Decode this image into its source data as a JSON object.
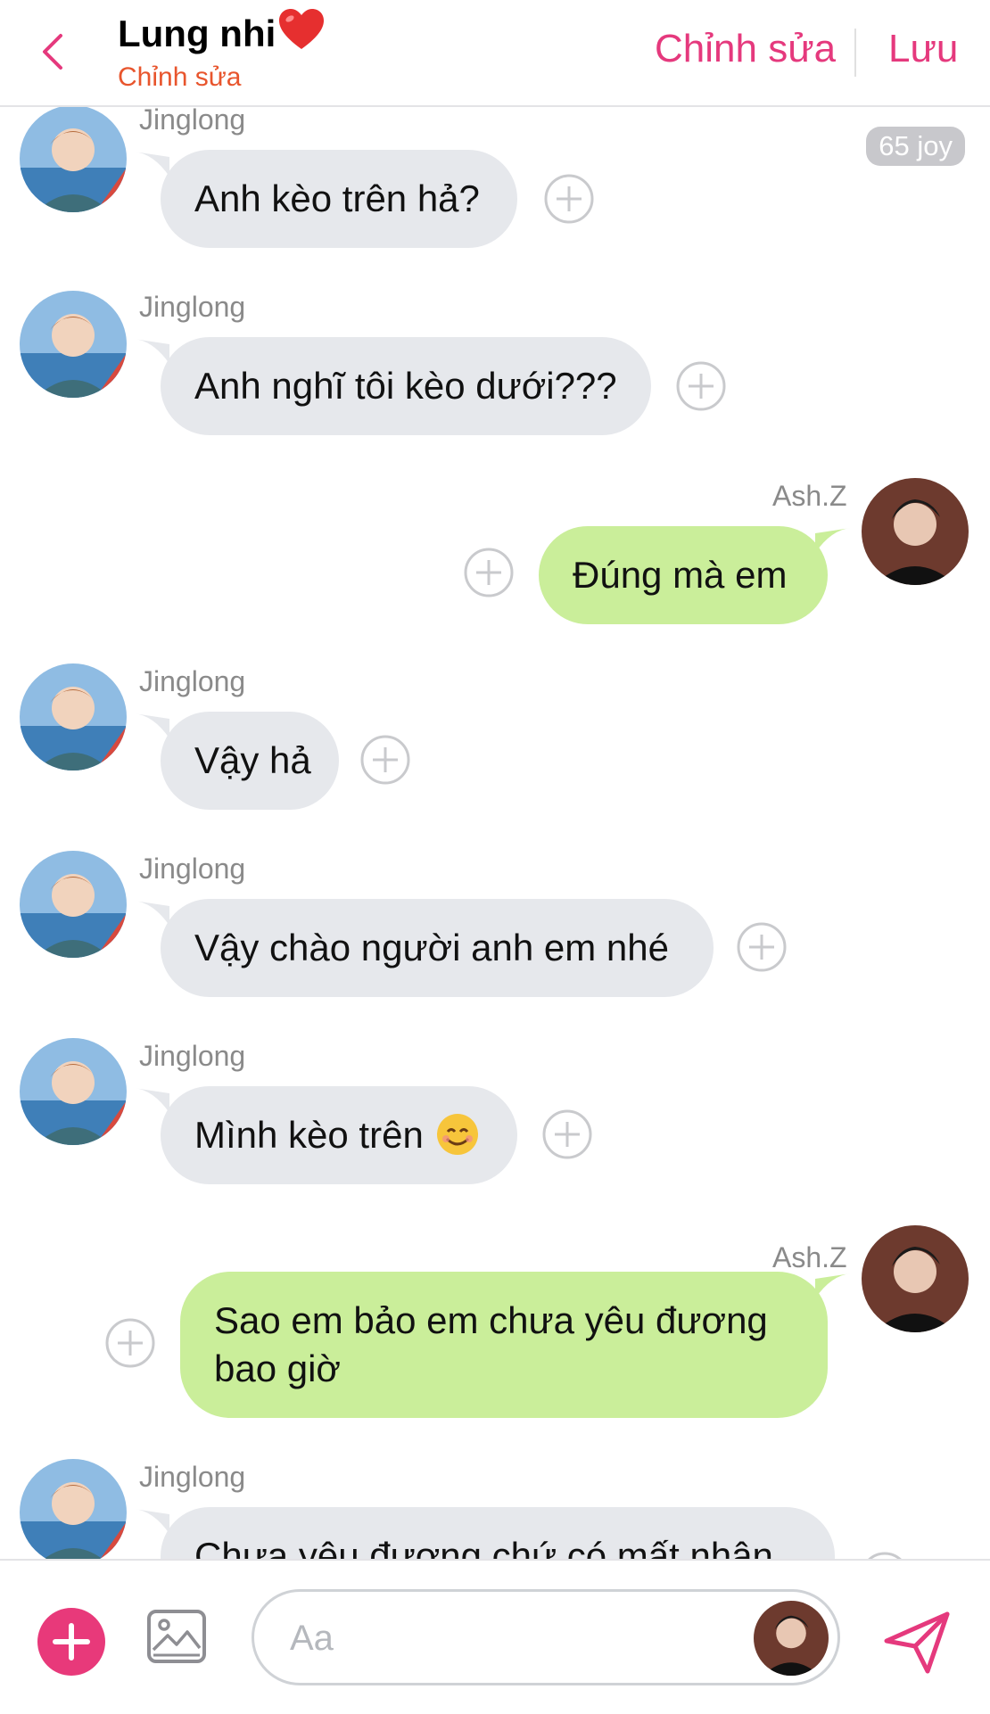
{
  "header": {
    "title": "Lung nhi",
    "subtitle": "Chỉnh sửa",
    "edit_label": "Chỉnh sửa",
    "save_label": "Lưu"
  },
  "joy_badge": "65 joy",
  "messages": [
    {
      "sender": "Jinglong",
      "text": "Anh kèo trên hả?"
    },
    {
      "sender": "Jinglong",
      "text": "Anh nghĩ tôi kèo dưới???"
    },
    {
      "sender": "Ash.Z",
      "text": "Đúng mà em"
    },
    {
      "sender": "Jinglong",
      "text": "Vậy hả"
    },
    {
      "sender": "Jinglong",
      "text": "Vậy chào người anh em nhé"
    },
    {
      "sender": "Jinglong",
      "text": "Mình kèo trên"
    },
    {
      "sender": "Ash.Z",
      "text": "Sao em bảo em chưa yêu đương bao giờ"
    },
    {
      "sender": "Jinglong",
      "text": "Chưa yêu đương chứ có mất nhân"
    }
  ],
  "composer": {
    "placeholder": "Aa"
  },
  "colors": {
    "accent": "#e5397d",
    "subtitle": "#e8552d",
    "incoming_bubble": "#e6e8ec",
    "outgoing_bubble": "#caee9a"
  },
  "icons": [
    "back-chevron-icon",
    "heart-icon",
    "add-reaction-icon",
    "smile-emoji-icon",
    "plus-icon",
    "image-icon",
    "send-icon"
  ]
}
